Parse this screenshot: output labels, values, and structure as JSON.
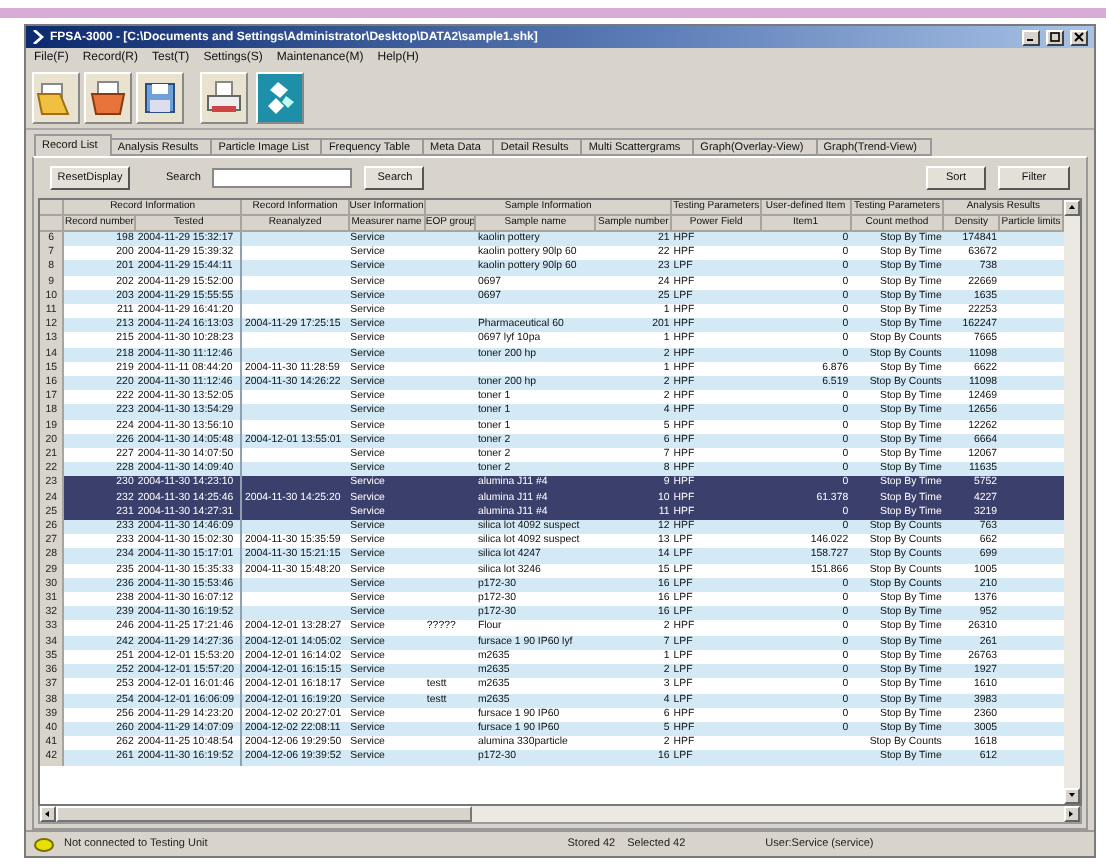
{
  "window": {
    "title": "FPSA-3000 - [C:\\Documents and Settings\\Administrator\\Desktop\\DATA2\\sample1.shk]"
  },
  "menu": [
    "File(F)",
    "Record(R)",
    "Test(T)",
    "Settings(S)",
    "Maintenance(M)",
    "Help(H)"
  ],
  "tabs": [
    {
      "label": "Record List",
      "selected": true
    },
    {
      "label": "Analysis Results",
      "selected": false
    },
    {
      "label": "Particle Image List",
      "selected": false
    },
    {
      "label": "Frequency Table",
      "selected": false
    },
    {
      "label": "Meta Data",
      "selected": false
    },
    {
      "label": "Detail Results",
      "selected": false
    },
    {
      "label": "Multi Scattergrams",
      "selected": false
    },
    {
      "label": "Graph(Overlay-View)",
      "selected": false
    },
    {
      "label": "Graph(Trend-View)",
      "selected": false
    }
  ],
  "controls": {
    "reset_button": "ResetDisplay",
    "search_label": "Search",
    "search_button": "Search",
    "sort_button": "Sort",
    "filter_button": "Filter"
  },
  "table": {
    "groups": [
      {
        "label": "Record Information",
        "columns": [
          "Record number",
          "Tested"
        ]
      },
      {
        "label": "Record Information",
        "columns": [
          "Reanalyzed"
        ]
      },
      {
        "label": "User Information",
        "columns": [
          "Measurer name"
        ]
      },
      {
        "label": "Sample Information",
        "columns": [
          "EOP group",
          "Sample name",
          "Sample number"
        ]
      },
      {
        "label": "Testing Parameters",
        "columns": [
          "Power Field"
        ]
      },
      {
        "label": "User-defined Item",
        "columns": [
          "Item1"
        ]
      },
      {
        "label": "Testing Parameters",
        "columns": [
          "Count method"
        ]
      },
      {
        "label": "Analysis Results",
        "columns": [
          "Density",
          "Particle limits"
        ]
      }
    ],
    "rows": [
      {
        "index": "6",
        "selected": false,
        "record_number": "198",
        "tested": "2004-11-29 15:32:17",
        "measurer_name": "Service",
        "sample_name": "kaolin pottery",
        "sample_number": "21",
        "power_field": "HPF",
        "item1": "0",
        "count_method": "Stop By Time",
        "density": "174841"
      },
      {
        "index": "7",
        "selected": false,
        "record_number": "200",
        "tested": "2004-11-29 15:39:32",
        "measurer_name": "Service",
        "sample_name": "kaolin pottery 90lp 60",
        "sample_number": "22",
        "power_field": "HPF",
        "item1": "0",
        "count_method": "Stop By Time",
        "density": "63672"
      },
      {
        "index": "8",
        "selected": false,
        "record_number": "201",
        "tested": "2004-11-29 15:44:11",
        "measurer_name": "Service",
        "sample_name": "kaolin pottery 90lp 60",
        "sample_number": "23",
        "power_field": "LPF",
        "item1": "0",
        "count_method": "Stop By Time",
        "density": "738"
      },
      {
        "index": "9",
        "selected": false,
        "record_number": "202",
        "tested": "2004-11-29 15:52:00",
        "measurer_name": "Service",
        "sample_name": "0697",
        "sample_number": "24",
        "power_field": "HPF",
        "item1": "0",
        "count_method": "Stop By Time",
        "density": "22669"
      },
      {
        "index": "10",
        "selected": false,
        "record_number": "203",
        "tested": "2004-11-29 15:55:55",
        "measurer_name": "Service",
        "sample_name": "0697",
        "sample_number": "25",
        "power_field": "LPF",
        "item1": "0",
        "count_method": "Stop By Time",
        "density": "1635"
      },
      {
        "index": "11",
        "selected": false,
        "record_number": "211",
        "tested": "2004-11-29 16:41:20",
        "measurer_name": "Service",
        "sample_number": "1",
        "power_field": "HPF",
        "item1": "0",
        "count_method": "Stop By Time",
        "density": "22253"
      },
      {
        "index": "12",
        "selected": false,
        "record_number": "213",
        "tested": "2004-11-24 16:13:03",
        "reanalyzed": "2004-11-29 17:25:15",
        "measurer_name": "Service",
        "sample_name": "Pharmaceutical 60",
        "sample_number": "201",
        "power_field": "HPF",
        "item1": "0",
        "count_method": "Stop By Time",
        "density": "162247"
      },
      {
        "index": "13",
        "selected": false,
        "record_number": "215",
        "tested": "2004-11-30 10:28:23",
        "measurer_name": "Service",
        "sample_name": "0697 lyf 10pa",
        "sample_number": "1",
        "power_field": "HPF",
        "item1": "0",
        "count_method": "Stop By Counts",
        "density": "7665"
      },
      {
        "index": "14",
        "selected": false,
        "record_number": "218",
        "tested": "2004-11-30 11:12:46",
        "measurer_name": "Service",
        "sample_name": "toner 200 hp",
        "sample_number": "2",
        "power_field": "HPF",
        "item1": "0",
        "count_method": "Stop By Counts",
        "density": "11098"
      },
      {
        "index": "15",
        "selected": false,
        "record_number": "219",
        "tested": "2004-11-11 08:44:20",
        "reanalyzed": "2004-11-30 11:28:59",
        "measurer_name": "Service",
        "sample_number": "1",
        "power_field": "HPF",
        "item1": "6.876",
        "count_method": "Stop By Time",
        "density": "6622"
      },
      {
        "index": "16",
        "selected": false,
        "record_number": "220",
        "tested": "2004-11-30 11:12:46",
        "reanalyzed": "2004-11-30 14:26:22",
        "measurer_name": "Service",
        "sample_name": "toner 200 hp",
        "sample_number": "2",
        "power_field": "HPF",
        "item1": "6.519",
        "count_method": "Stop By Counts",
        "density": "11098"
      },
      {
        "index": "17",
        "selected": false,
        "record_number": "222",
        "tested": "2004-11-30 13:52:05",
        "measurer_name": "Service",
        "sample_name": "toner 1",
        "sample_number": "2",
        "power_field": "HPF",
        "item1": "0",
        "count_method": "Stop By Time",
        "density": "12469"
      },
      {
        "index": "18",
        "selected": false,
        "record_number": "223",
        "tested": "2004-11-30 13:54:29",
        "measurer_name": "Service",
        "sample_name": "toner 1",
        "sample_number": "4",
        "power_field": "HPF",
        "item1": "0",
        "count_method": "Stop By Time",
        "density": "12656"
      },
      {
        "index": "19",
        "selected": false,
        "record_number": "224",
        "tested": "2004-11-30 13:56:10",
        "measurer_name": "Service",
        "sample_name": "toner 1",
        "sample_number": "5",
        "power_field": "HPF",
        "item1": "0",
        "count_method": "Stop By Time",
        "density": "12262"
      },
      {
        "index": "20",
        "selected": false,
        "record_number": "226",
        "tested": "2004-11-30 14:05:48",
        "reanalyzed": "2004-12-01 13:55:01",
        "measurer_name": "Service",
        "sample_name": "toner 2",
        "sample_number": "6",
        "power_field": "HPF",
        "item1": "0",
        "count_method": "Stop By Time",
        "density": "6664"
      },
      {
        "index": "21",
        "selected": false,
        "record_number": "227",
        "tested": "2004-11-30 14:07:50",
        "measurer_name": "Service",
        "sample_name": "toner 2",
        "sample_number": "7",
        "power_field": "HPF",
        "item1": "0",
        "count_method": "Stop By Time",
        "density": "12067"
      },
      {
        "index": "22",
        "selected": false,
        "record_number": "228",
        "tested": "2004-11-30 14:09:40",
        "measurer_name": "Service",
        "sample_name": "toner 2",
        "sample_number": "8",
        "power_field": "HPF",
        "item1": "0",
        "count_method": "Stop By Time",
        "density": "11635"
      },
      {
        "index": "23",
        "selected": true,
        "record_number": "230",
        "tested": "2004-11-30 14:23:10",
        "measurer_name": "Service",
        "sample_name": "alumina J11 #4",
        "sample_number": "9",
        "power_field": "HPF",
        "item1": "0",
        "count_method": "Stop By Time",
        "density": "5752"
      },
      {
        "index": "24",
        "selected": true,
        "record_number": "232",
        "tested": "2004-11-30 14:25:46",
        "reanalyzed": "2004-11-30 14:25:20",
        "measurer_name": "Service",
        "sample_name": "alumina J11 #4",
        "sample_number": "10",
        "power_field": "HPF",
        "item1": "61.378",
        "count_method": "Stop By Time",
        "density": "4227"
      },
      {
        "index": "25",
        "selected": true,
        "record_number": "231",
        "tested": "2004-11-30 14:27:31",
        "measurer_name": "Service",
        "sample_name": "alumina J11 #4",
        "sample_number": "11",
        "power_field": "HPF",
        "item1": "0",
        "count_method": "Stop By Time",
        "density": "3219"
      },
      {
        "index": "26",
        "selected": false,
        "record_number": "233",
        "tested": "2004-11-30 14:46:09",
        "measurer_name": "Service",
        "sample_name": "silica lot 4092 suspect",
        "sample_number": "12",
        "power_field": "HPF",
        "item1": "0",
        "count_method": "Stop By Counts",
        "density": "763"
      },
      {
        "index": "27",
        "selected": false,
        "record_number": "233",
        "tested": "2004-11-30 15:02:30",
        "reanalyzed": "2004-11-30 15:35:59",
        "measurer_name": "Service",
        "sample_name": "silica lot 4092 suspect",
        "sample_number": "13",
        "power_field": "LPF",
        "item1": "146.022",
        "count_method": "Stop By Counts",
        "density": "662"
      },
      {
        "index": "28",
        "selected": false,
        "record_number": "234",
        "tested": "2004-11-30 15:17:01",
        "reanalyzed": "2004-11-30 15:21:15",
        "measurer_name": "Service",
        "sample_name": "silica lot 4247",
        "sample_number": "14",
        "power_field": "LPF",
        "item1": "158.727",
        "count_method": "Stop By Counts",
        "density": "699"
      },
      {
        "index": "29",
        "selected": false,
        "record_number": "235",
        "tested": "2004-11-30 15:35:33",
        "reanalyzed": "2004-11-30 15:48:20",
        "measurer_name": "Service",
        "sample_name": "silica lot 3246",
        "sample_number": "15",
        "power_field": "LPF",
        "item1": "151.866",
        "count_method": "Stop By Counts",
        "density": "1005"
      },
      {
        "index": "30",
        "selected": false,
        "record_number": "236",
        "tested": "2004-11-30 15:53:46",
        "measurer_name": "Service",
        "sample_name": "p172-30",
        "sample_number": "16",
        "power_field": "LPF",
        "item1": "0",
        "count_method": "Stop By Counts",
        "density": "210"
      },
      {
        "index": "31",
        "selected": false,
        "record_number": "238",
        "tested": "2004-11-30 16:07:12",
        "measurer_name": "Service",
        "sample_name": "p172-30",
        "sample_number": "16",
        "power_field": "LPF",
        "item1": "0",
        "count_method": "Stop By Time",
        "density": "1376"
      },
      {
        "index": "32",
        "selected": false,
        "record_number": "239",
        "tested": "2004-11-30 16:19:52",
        "measurer_name": "Service",
        "sample_name": "p172-30",
        "sample_number": "16",
        "power_field": "LPF",
        "item1": "0",
        "count_method": "Stop By Time",
        "density": "952"
      },
      {
        "index": "33",
        "selected": false,
        "record_number": "246",
        "tested": "2004-11-25 17:21:46",
        "reanalyzed": "2004-12-01 13:28:27",
        "measurer_name": "Service",
        "eop_group": "?????",
        "sample_name": "Flour",
        "sample_number": "2",
        "power_field": "HPF",
        "item1": "0",
        "count_method": "Stop By Time",
        "density": "26310"
      },
      {
        "index": "34",
        "selected": false,
        "record_number": "242",
        "tested": "2004-11-29 14:27:36",
        "reanalyzed": "2004-12-01 14:05:02",
        "measurer_name": "Service",
        "sample_name": "fursace 1 90 IP60 lyf",
        "sample_number": "7",
        "power_field": "LPF",
        "item1": "0",
        "count_method": "Stop By Time",
        "density": "261"
      },
      {
        "index": "35",
        "selected": false,
        "record_number": "251",
        "tested": "2004-12-01 15:53:20",
        "reanalyzed": "2004-12-01 16:14:02",
        "measurer_name": "Service",
        "sample_name": "m2635",
        "sample_number": "1",
        "power_field": "LPF",
        "item1": "0",
        "count_method": "Stop By Time",
        "density": "26763"
      },
      {
        "index": "36",
        "selected": false,
        "record_number": "252",
        "tested": "2004-12-01 15:57:20",
        "reanalyzed": "2004-12-01 16:15:15",
        "measurer_name": "Service",
        "sample_name": "m2635",
        "sample_number": "2",
        "power_field": "LPF",
        "item1": "0",
        "count_method": "Stop By Time",
        "density": "1927"
      },
      {
        "index": "37",
        "selected": false,
        "record_number": "253",
        "tested": "2004-12-01 16:01:46",
        "reanalyzed": "2004-12-01 16:18:17",
        "measurer_name": "Service",
        "eop_group": "testt",
        "sample_name": "m2635",
        "sample_number": "3",
        "power_field": "LPF",
        "item1": "0",
        "count_method": "Stop By Time",
        "density": "1610"
      },
      {
        "index": "38",
        "selected": false,
        "record_number": "254",
        "tested": "2004-12-01 16:06:09",
        "reanalyzed": "2004-12-01 16:19:20",
        "measurer_name": "Service",
        "eop_group": "testt",
        "sample_name": "m2635",
        "sample_number": "4",
        "power_field": "LPF",
        "item1": "0",
        "count_method": "Stop By Time",
        "density": "3983"
      },
      {
        "index": "39",
        "selected": false,
        "record_number": "256",
        "tested": "2004-11-29 14:23:20",
        "reanalyzed": "2004-12-02 20:27:01",
        "measurer_name": "Service",
        "sample_name": "fursace 1 90 IP60",
        "sample_number": "6",
        "power_field": "HPF",
        "item1": "0",
        "count_method": "Stop By Time",
        "density": "2360"
      },
      {
        "index": "40",
        "selected": false,
        "record_number": "260",
        "tested": "2004-11-29 14:07:09",
        "reanalyzed": "2004-12-02 22:08:11",
        "measurer_name": "Service",
        "sample_name": "fursace 1 90 IP60",
        "sample_number": "5",
        "power_field": "HPF",
        "item1": "0",
        "count_method": "Stop By Time",
        "density": "3005"
      },
      {
        "index": "41",
        "selected": false,
        "record_number": "262",
        "tested": "2004-11-25 10:48:54",
        "reanalyzed": "2004-12-06 19:29:50",
        "measurer_name": "Service",
        "sample_name": "alumina 330particle",
        "sample_number": "2",
        "power_field": "HPF",
        "count_method": "Stop By Counts",
        "density": "1618"
      },
      {
        "index": "42",
        "selected": false,
        "record_number": "261",
        "tested": "2004-11-30 16:19:52",
        "reanalyzed": "2004-12-06 19:39:52",
        "measurer_name": "Service",
        "sample_name": "p172-30",
        "sample_number": "16",
        "power_field": "LPF",
        "count_method": "Stop By Time",
        "density": "612"
      }
    ]
  },
  "status_bar": {
    "connection": "Not connected to Testing Unit",
    "stored": "Stored 42",
    "selected_count": "Selected 42",
    "user": "User:Service (service)"
  }
}
